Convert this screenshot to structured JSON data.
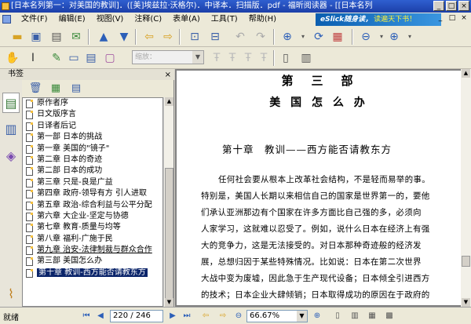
{
  "window": {
    "title": "[日本名列第一：对美国的教训]．([美]埃兹拉·沃格尔)．中译本．扫描版．pdf - 福昕阅读器 - [[日本名列",
    "controls": [
      "_",
      "□",
      "×"
    ]
  },
  "menu": {
    "items": [
      "文件(F)",
      "编辑(E)",
      "视图(V)",
      "注释(C)",
      "表单(A)",
      "工具(T)",
      "帮助(H)"
    ],
    "banner_text": "eSlick随身读，",
    "banner_text2": "读遍天下书！",
    "window_controls": [
      "_",
      "□",
      "×"
    ]
  },
  "toolbar": {
    "zoom_placeholder": "缩放："
  },
  "sidebar": {
    "header": "书签",
    "close": "×",
    "bookmarks": [
      {
        "label": "原作者序"
      },
      {
        "label": "日文版序言"
      },
      {
        "label": "日译者后记"
      },
      {
        "label": "第一部 日本的挑战"
      },
      {
        "label": "第一章 美国的\"镜子\""
      },
      {
        "label": "第二章 日本的奇迹"
      },
      {
        "label": "第二部 日本的成功"
      },
      {
        "label": "第三章 只是-良是广益"
      },
      {
        "label": "第四章 政府-领导有方 引人进取"
      },
      {
        "label": "第五章 政治-综合利益与公平分配"
      },
      {
        "label": "第六章 大企业-坚定与协德"
      },
      {
        "label": "第七章 教育-质量与均等"
      },
      {
        "label": "第八章 福利-广施于民"
      },
      {
        "label": "第九章 治安-法律制裁与群众合作"
      },
      {
        "label": "第三部 美国怎么办"
      },
      {
        "label": "第十章 教训-西方能否请教东方"
      }
    ],
    "selected_index": 15,
    "underlined_index": 13
  },
  "document": {
    "part_title": "第　三　部",
    "part_subtitle": "美 国 怎 么 办",
    "chapter_title": "第十章　教训——西方能否请教东方",
    "paragraph_lines": [
      "任何社会要从根本上改革社会结构，不是轻而易举的事。",
      "特别是，美国人长期以来相信自己的国家是世界第一的，要他",
      "们承认亚洲那边有个国家在许多方面比自己强的多，必须向",
      "人家学习，这就难以忍受了。例如，说什么日本在经济上有强",
      "大的竞争力，这是无法接受的。对日本那种奇迹般的经济发",
      "展，总想归因于某些特殊情况。比如说：日本在第二次世界",
      "大战中变为废墟，因此急于生产现代设备；日本倾全引进西方",
      "的技术；日本企业大肆倾销；日本取得成功的原因在于政府的"
    ]
  },
  "status": {
    "text": "就绪",
    "page_value": "220 / 246",
    "zoom_value": "66.67%"
  }
}
